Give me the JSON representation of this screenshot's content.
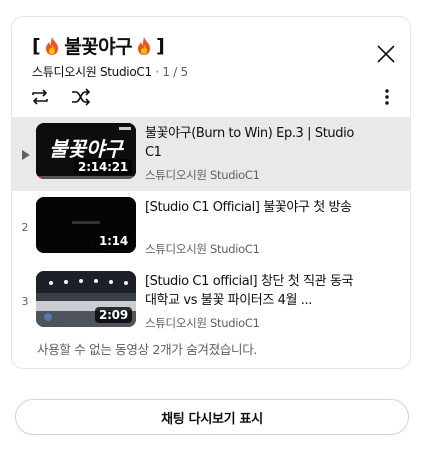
{
  "playlist": {
    "title_open": "[",
    "title_text": "불꽃야구",
    "title_close": "]",
    "channel": "스튜디오시원 StudioC1",
    "separator": "·",
    "position": "1 / 5",
    "icons": {
      "close": "close-icon",
      "loop": "loop-icon",
      "shuffle": "shuffle-icon",
      "more": "more-vert-icon",
      "flame": "fire-emoji-icon",
      "now_playing": "play-arrow-icon"
    },
    "items": [
      {
        "index": "▶",
        "title": "불꽃야구(Burn to Win) Ep.3 | Studio C1",
        "channel": "스튜디오시원 StudioC1",
        "duration": "2:14:21",
        "thumb_text": "불꽃야구",
        "active": true,
        "watched_fraction": 0.04
      },
      {
        "index": "2",
        "title": "[Studio C1 Official] 불꽃야구 첫 방송",
        "channel": "스튜디오시원 StudioC1",
        "duration": "1:14",
        "active": false
      },
      {
        "index": "3",
        "title": "[Studio C1 official] 창단 첫 직관 동국대학교 vs 불꽃 파이터즈 4월 ...",
        "channel": "스튜디오시원 StudioC1",
        "duration": "2:09",
        "active": false
      }
    ],
    "hidden_note": "사용할 수 없는 동영상 2개가 숨겨졌습니다."
  },
  "chat_replay_button": "채팅 다시보기 표시",
  "colors": {
    "active_row_bg": "#e9e9e9",
    "secondary_text": "#606060",
    "progress_red": "#ff0033",
    "border": "#e5e5e5"
  }
}
